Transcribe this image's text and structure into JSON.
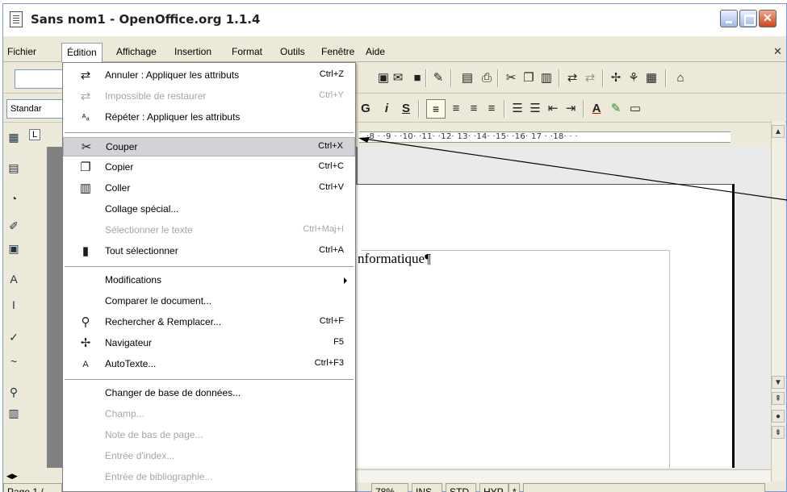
{
  "window": {
    "title": "Sans nom1 - OpenOffice.org 1.1.4"
  },
  "menubar": {
    "items": [
      "Fichier",
      "Édition",
      "Affichage",
      "Insertion",
      "Format",
      "Outils",
      "Fenêtre",
      "Aide"
    ],
    "active": "Édition"
  },
  "toolbar": {
    "style_value": "Standar"
  },
  "ruler": {
    "text": "·8 · ·9 · ·10· ·11·  ·12·  13· ·14· ·15· ·16·  17 · ·18· · ·"
  },
  "document": {
    "text": "nformatique¶"
  },
  "statusbar": {
    "page": "Page 1 /",
    "zoom": "78%",
    "ins": "INS",
    "std": "STD",
    "hyp": "HYP",
    "modified": "*"
  },
  "edit_menu": {
    "items": [
      {
        "icon": "undo-icon",
        "glyph": "⇄",
        "label": "Annuler : Appliquer les attributs",
        "shortcut": "Ctrl+Z",
        "disabled": false
      },
      {
        "icon": "redo-icon",
        "glyph": "⇄",
        "label": "Impossible de restaurer",
        "shortcut": "Ctrl+Y",
        "disabled": true
      },
      {
        "icon": "repeat-icon",
        "glyph": "ᴬₐ",
        "label": "Répéter : Appliquer les attributs",
        "shortcut": "",
        "disabled": false
      },
      {
        "icon": "cut-icon",
        "glyph": "✂",
        "label": "Couper",
        "shortcut": "Ctrl+X",
        "disabled": false,
        "highlight": true
      },
      {
        "icon": "copy-icon",
        "glyph": "❐",
        "label": "Copier",
        "shortcut": "Ctrl+C",
        "disabled": false
      },
      {
        "icon": "paste-icon",
        "glyph": "📋",
        "label": "Coller",
        "shortcut": "Ctrl+V",
        "disabled": false
      },
      {
        "icon": "",
        "glyph": "",
        "label": "Collage spécial...",
        "shortcut": "",
        "disabled": false
      },
      {
        "icon": "",
        "glyph": "",
        "label": "Sélectionner le texte",
        "shortcut": "Ctrl+Maj+I",
        "disabled": true
      },
      {
        "icon": "select-all-icon",
        "glyph": "▮",
        "label": "Tout sélectionner",
        "shortcut": "Ctrl+A",
        "disabled": false
      },
      {
        "icon": "",
        "glyph": "",
        "label": "Modifications",
        "shortcut": "",
        "disabled": false,
        "submenu": true
      },
      {
        "icon": "",
        "glyph": "",
        "label": "Comparer le document...",
        "shortcut": "",
        "disabled": false
      },
      {
        "icon": "binoculars-icon",
        "glyph": "⚲",
        "label": "Rechercher & Remplacer...",
        "shortcut": "Ctrl+F",
        "disabled": false
      },
      {
        "icon": "navigator-icon",
        "glyph": "✢",
        "label": "Navigateur",
        "shortcut": "F5",
        "disabled": false
      },
      {
        "icon": "autotext-icon",
        "glyph": "A",
        "label": "AutoTexte...",
        "shortcut": "Ctrl+F3",
        "disabled": false
      },
      {
        "icon": "",
        "glyph": "",
        "label": "Changer de base de données...",
        "shortcut": "",
        "disabled": false
      },
      {
        "icon": "",
        "glyph": "",
        "label": "Champ...",
        "shortcut": "",
        "disabled": true
      },
      {
        "icon": "",
        "glyph": "",
        "label": "Note de bas de page...",
        "shortcut": "",
        "disabled": true
      },
      {
        "icon": "",
        "glyph": "",
        "label": "Entrée d'index...",
        "shortcut": "",
        "disabled": true
      },
      {
        "icon": "",
        "glyph": "",
        "label": "Entrée de bibliographie...",
        "shortcut": "",
        "disabled": true
      }
    ]
  }
}
